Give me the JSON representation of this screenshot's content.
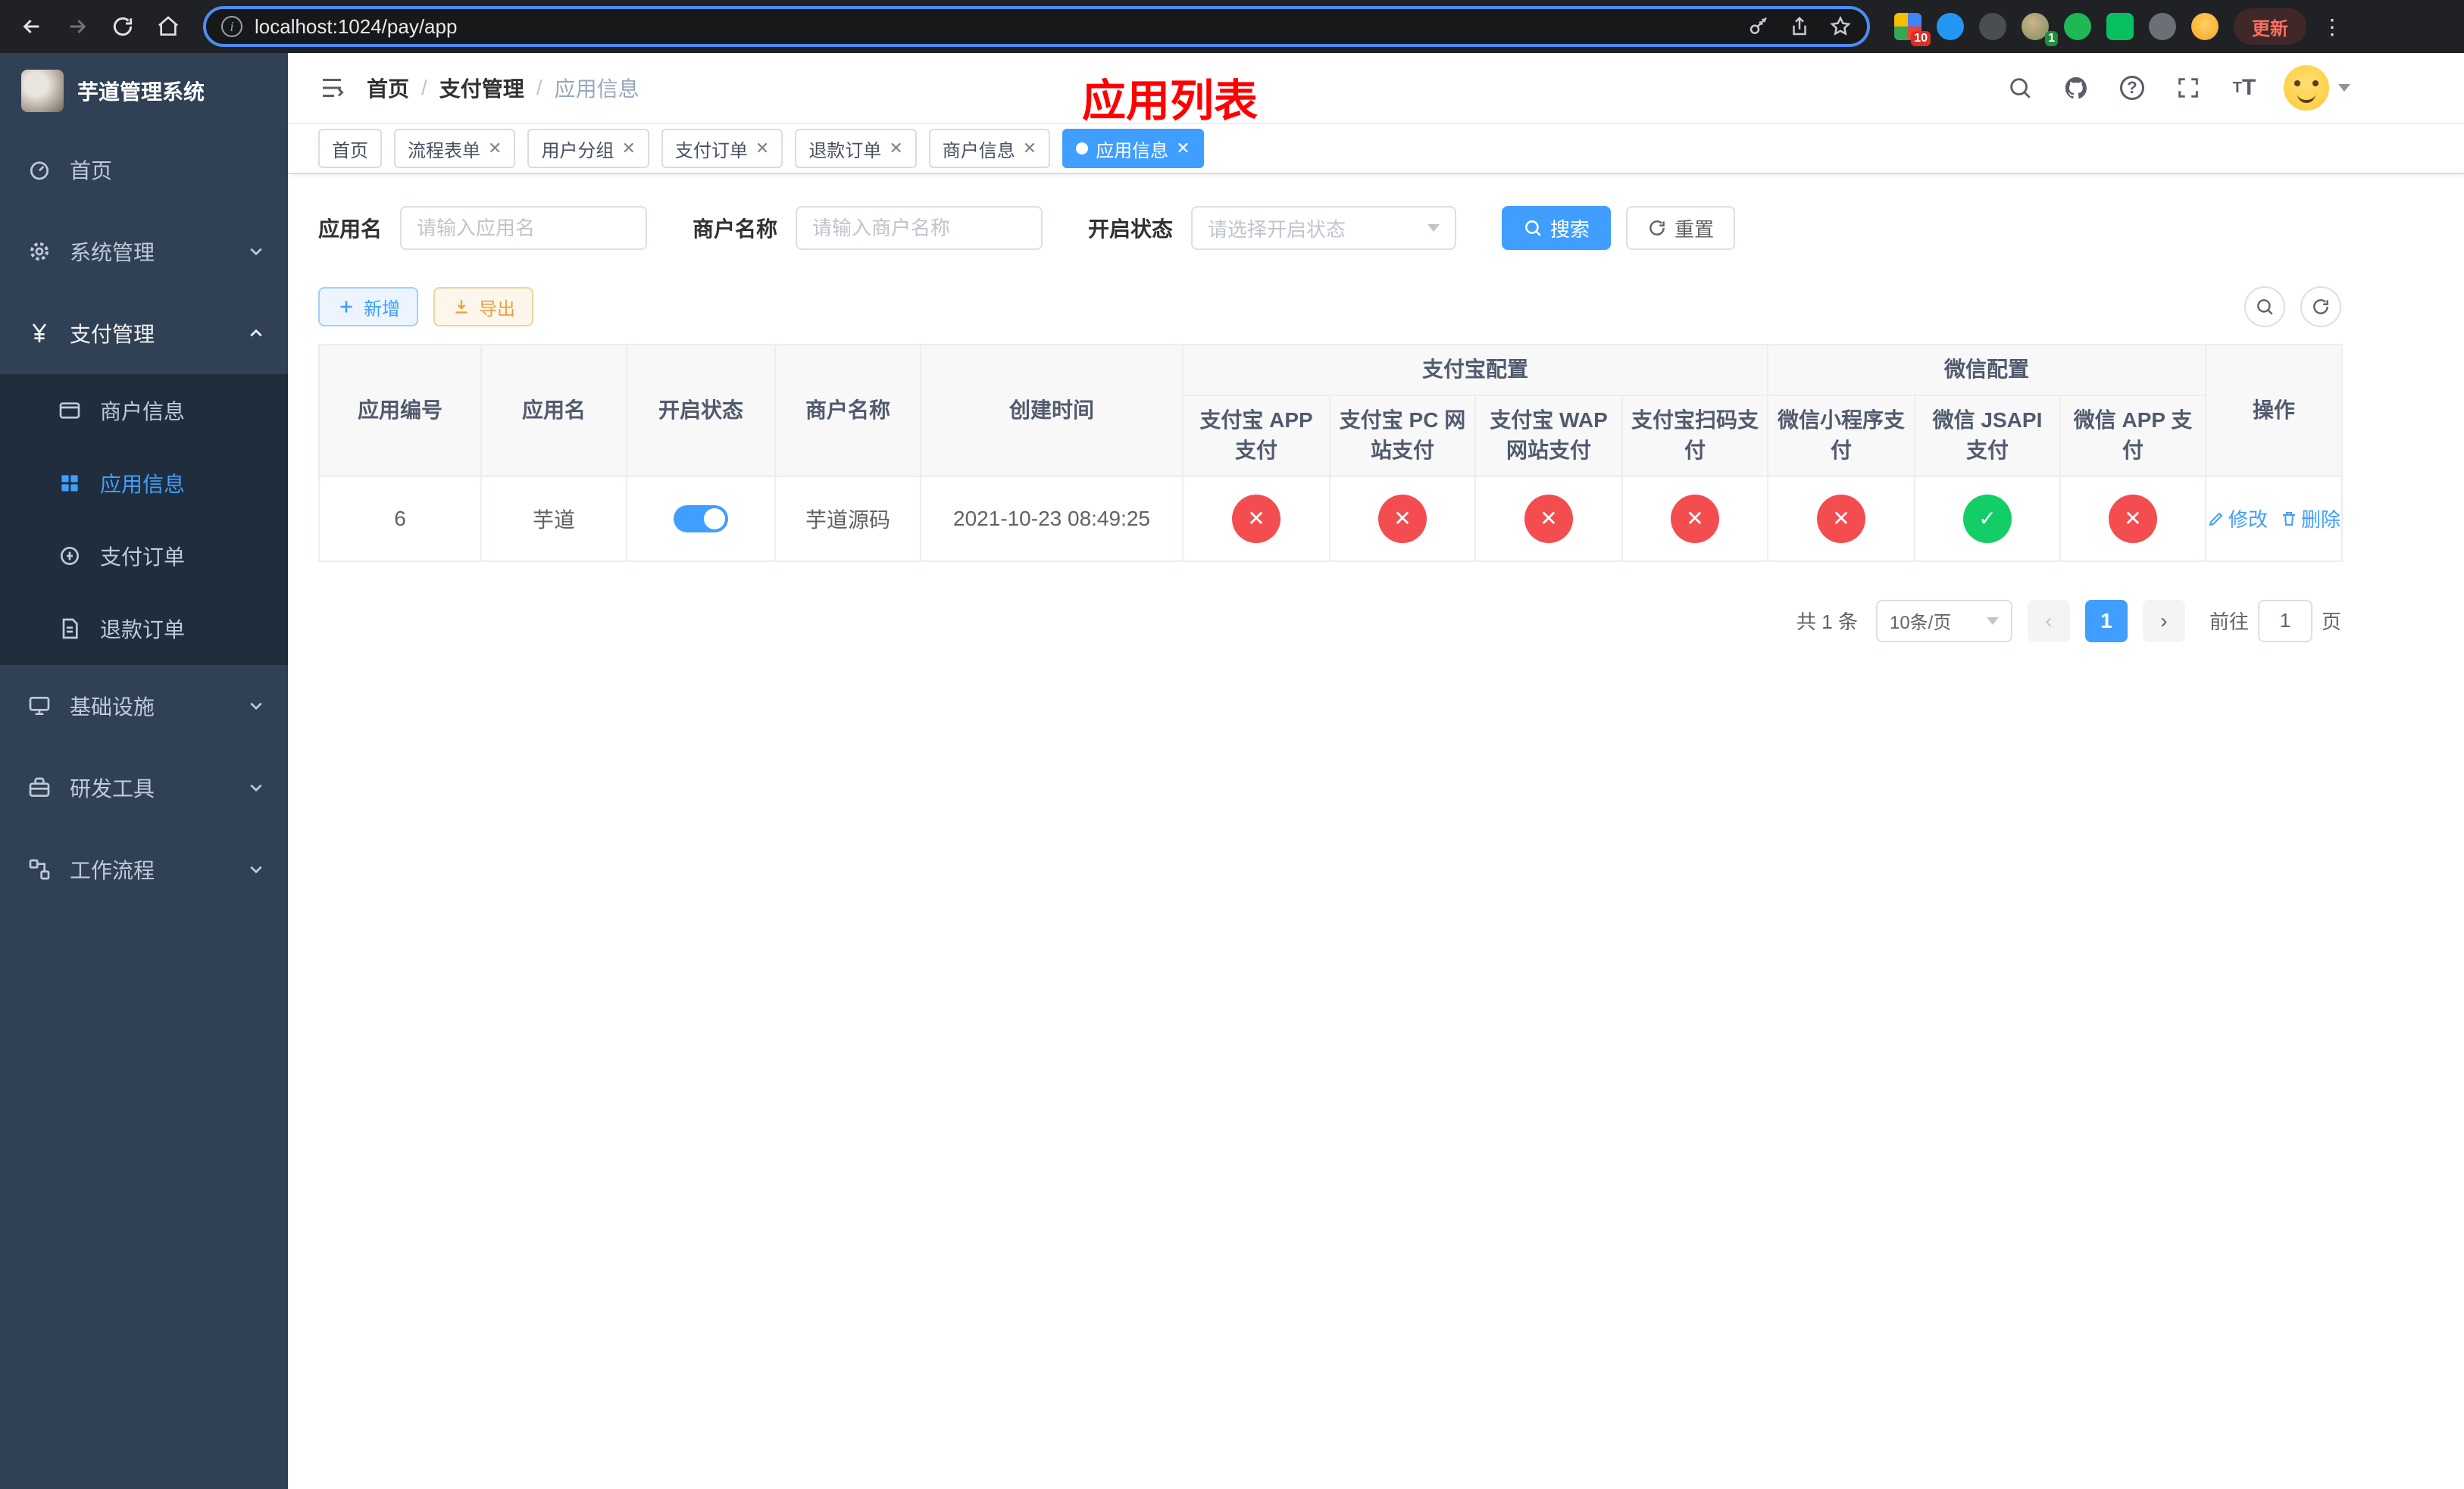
{
  "browser": {
    "url": "localhost:1024/pay/app",
    "update_label": "更新",
    "extension_badges": {
      "grid_badge": "10",
      "profile_badge": "1"
    }
  },
  "colors": {
    "primary": "#409EFF",
    "success": "#13ce66",
    "danger": "#f34d50",
    "warning": "#e6a23c",
    "annotation_red": "#ff0000",
    "sidebar_bg": "#304156",
    "submenu_bg": "#1f2d3d"
  },
  "glyphs": {
    "check": "✓",
    "cross": "✕"
  },
  "sidebar": {
    "title": "芋道管理系统",
    "items": [
      {
        "label": "首页"
      },
      {
        "label": "系统管理"
      },
      {
        "label": "支付管理",
        "children": [
          {
            "label": "商户信息"
          },
          {
            "label": "应用信息"
          },
          {
            "label": "支付订单"
          },
          {
            "label": "退款订单"
          }
        ]
      },
      {
        "label": "基础设施"
      },
      {
        "label": "研发工具"
      },
      {
        "label": "工作流程"
      }
    ]
  },
  "header": {
    "breadcrumbs": [
      "首页",
      "支付管理",
      "应用信息"
    ],
    "annotation": "应用列表"
  },
  "tabs": [
    {
      "label": "首页"
    },
    {
      "label": "流程表单"
    },
    {
      "label": "用户分组"
    },
    {
      "label": "支付订单"
    },
    {
      "label": "退款订单"
    },
    {
      "label": "商户信息"
    },
    {
      "label": "应用信息"
    }
  ],
  "filters": {
    "app_name": {
      "label": "应用名",
      "placeholder": "请输入应用名",
      "value": ""
    },
    "merchant_name": {
      "label": "商户名称",
      "placeholder": "请输入商户名称",
      "value": ""
    },
    "status": {
      "label": "开启状态",
      "placeholder": "请选择开启状态"
    },
    "search_label": "搜索",
    "reset_label": "重置"
  },
  "toolbar": {
    "add_label": "新增",
    "export_label": "导出"
  },
  "table": {
    "plain_cols": [
      "应用编号",
      "应用名",
      "开启状态",
      "商户名称",
      "创建时间"
    ],
    "groups": {
      "alipay": "支付宝配置",
      "wechat": "微信配置"
    },
    "alipay_cols": [
      "支付宝 APP 支付",
      "支付宝 PC 网站支付",
      "支付宝 WAP 网站支付",
      "支付宝扫码支付"
    ],
    "wechat_cols": [
      "微信小程序支付",
      "微信 JSAPI 支付",
      "微信 APP 支付"
    ],
    "ops_col": "操作",
    "row": {
      "id": "6",
      "name": "芋道",
      "enabled": true,
      "merchant": "芋道源码",
      "created_at": "2021-10-23 08:49:25",
      "channels": {
        "alipay_app": false,
        "alipay_pc": false,
        "alipay_wap": false,
        "alipay_qr": false,
        "wx_lite": false,
        "wx_jsapi": true,
        "wx_app": false
      },
      "edit_label": "修改",
      "delete_label": "删除"
    }
  },
  "pagination": {
    "total_text": "共 1 条",
    "page_size_text": "10条/页",
    "page": "1",
    "goto_prefix": "前往",
    "goto_value": "1",
    "goto_suffix": "页"
  }
}
